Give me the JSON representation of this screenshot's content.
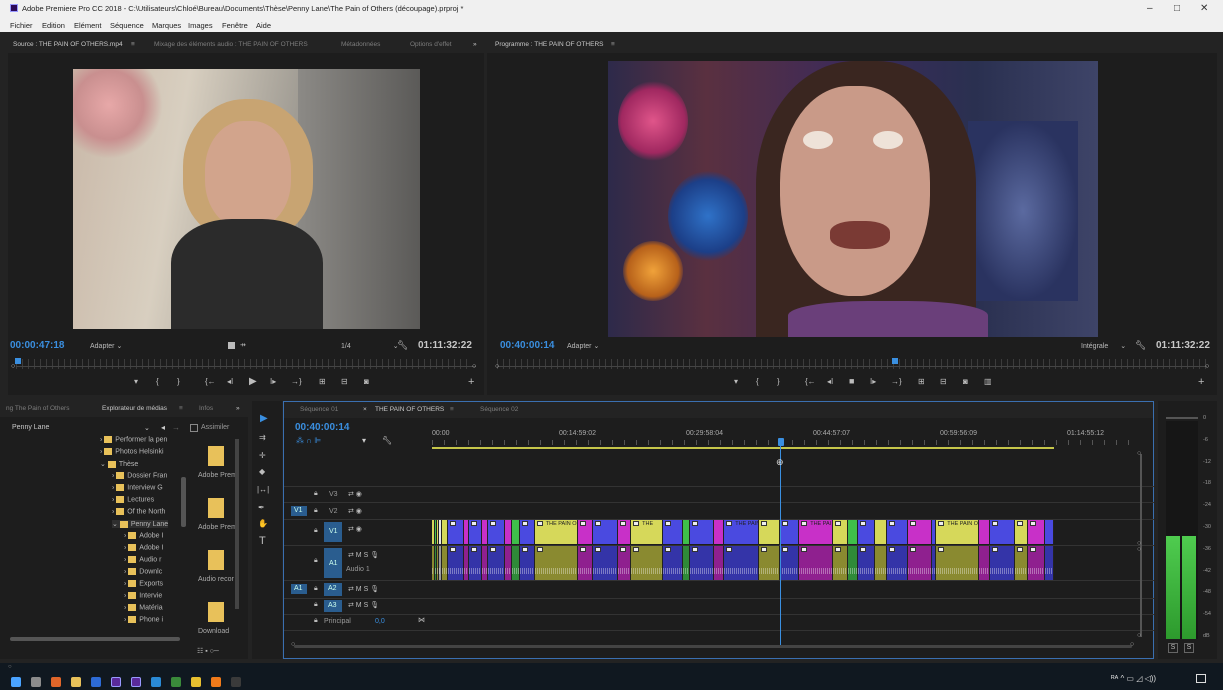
{
  "window": {
    "title": "Adobe Premiere Pro CC 2018 - C:\\Utilisateurs\\Chloé\\Bureau\\Documents\\Thèse\\Penny Lane\\The Pain of Others (découpage).prproj *",
    "minimize": "–",
    "maximize": "□",
    "close": "✕"
  },
  "menu": [
    "Fichier",
    "Edition",
    "Elément",
    "Séquence",
    "Marques",
    "Images",
    "Fenêtre",
    "Aide"
  ],
  "source_panel": {
    "tabs": [
      "Source : THE PAIN OF OTHERS.mp4",
      "Mixage des éléments audio : THE PAIN OF OTHERS",
      "Métadonnées",
      "Options d'effet"
    ],
    "more": "»",
    "menu_icon": "≡",
    "timecode": "00:00:47:18",
    "fit": "Adapter",
    "resolution": "1/4",
    "duration": "01:11:32:22"
  },
  "program_panel": {
    "tab": "Programme : THE PAIN OF OTHERS",
    "menu_icon": "≡",
    "timecode": "00:40:00:14",
    "fit": "Adapter",
    "resolution": "Intégrale",
    "duration": "01:11:32:22"
  },
  "media_panel": {
    "tabs": [
      "ng The Pain of Others",
      "Explorateur de médias",
      "Infos"
    ],
    "tab_menu": "≡",
    "more": "»",
    "path": "Penny Lane",
    "ingest": "Assimiler",
    "tree": [
      {
        "label": "Performer la pen",
        "depth": 1
      },
      {
        "label": "Photos Helsinki",
        "depth": 1
      },
      {
        "label": "Thèse",
        "depth": 1
      },
      {
        "label": "Dossier Fran",
        "depth": 2
      },
      {
        "label": "Interview G",
        "depth": 2
      },
      {
        "label": "Lectures",
        "depth": 2
      },
      {
        "label": "Of the North",
        "depth": 2
      },
      {
        "label": "Penny Lane",
        "depth": 2
      },
      {
        "label": "Adobe I",
        "depth": 3
      },
      {
        "label": "Adobe I",
        "depth": 3
      },
      {
        "label": "Audio r",
        "depth": 3
      },
      {
        "label": "Downlc",
        "depth": 3
      },
      {
        "label": "Exports",
        "depth": 3
      },
      {
        "label": "Intervie",
        "depth": 3
      },
      {
        "label": "Matéria",
        "depth": 3
      },
      {
        "label": "Phone i",
        "depth": 3
      }
    ],
    "thumbs": [
      "Adobe Prem",
      "Adobe Prem",
      "Audio recor",
      "Download"
    ]
  },
  "timeline": {
    "tabs": [
      "Séquence 01",
      "THE PAIN OF OTHERS",
      "Séquence 02"
    ],
    "close_x": "×",
    "tab_menu": "≡",
    "timecode": "00:40:00:14",
    "ruler": [
      "00:00",
      "00:14:59:02",
      "00:29:58:04",
      "00:44:57:07",
      "00:59:56:09",
      "01:14:55:12"
    ],
    "tracks": {
      "video": [
        "V3",
        "V2",
        "V1"
      ],
      "audio": [
        "A1",
        "A2",
        "A3"
      ],
      "audio1_name": "Audio 1",
      "master": "Principal",
      "master_value": "0,0"
    },
    "clip_label": "THE PAIN OF O",
    "clip_labels_short": [
      "THE",
      "THE PAIN",
      "THE PAI",
      "THE PAIN OF",
      "THE",
      "THE PAIN"
    ],
    "playhead_fraction": 0.555
  },
  "meter": {
    "scale": [
      "0",
      "-6",
      "-12",
      "-18",
      "-24",
      "-30",
      "-36",
      "-42",
      "-48",
      "-54",
      "dB"
    ],
    "solo": [
      "S",
      "S"
    ],
    "level_db": -30
  },
  "colors": {
    "accent_blue": "#3a8fe0",
    "clip_yellow": "#d6d85a",
    "clip_blue": "#4a4ae0",
    "clip_magenta": "#c830c8",
    "clip_green": "#3fbf4a",
    "meter_green": "#3cc03c"
  },
  "taskbar": {
    "icons": [
      "windows-start",
      "task-view",
      "firefox",
      "explorer",
      "edge",
      "premiere",
      "premiere-2",
      "photos",
      "media",
      "chrome",
      "vlc",
      "app"
    ],
    "tray": "ᴿᴬ ^ ▭ ◿ ◁))"
  }
}
